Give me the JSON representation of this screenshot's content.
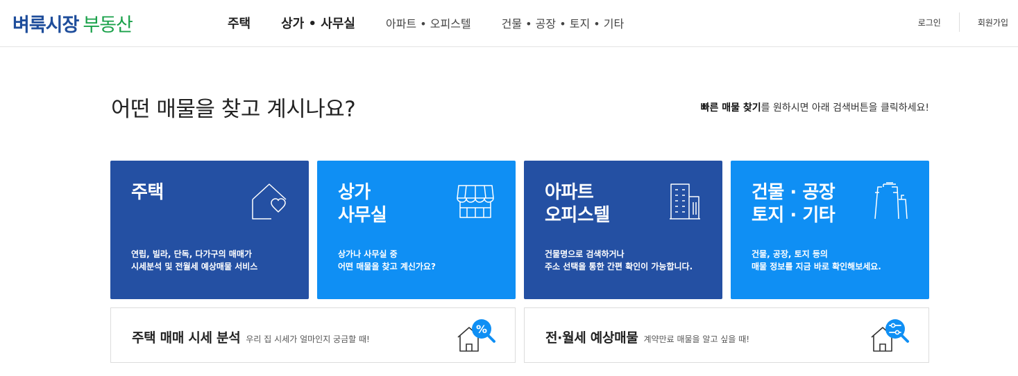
{
  "header": {
    "logo_primary": "벼룩시장",
    "logo_secondary": "부동산",
    "nav": [
      "주택",
      "상가 • 사무실",
      "아파트 • 오피스텔",
      "건물 • 공장 • 토지 • 기타"
    ],
    "login": "로그인",
    "signup": "회원가입"
  },
  "main": {
    "headline": "어떤 매물을 찾고 계시나요?",
    "hint_bold": "빠른 매물 찾기",
    "hint_rest": "를 원하시면 아래 검색버튼을 클릭하세요!"
  },
  "cards": [
    {
      "title": "주택",
      "desc": "연립, 빌라, 단독, 다가구의 매매가\n시세분석 및 전월세 예상매물 서비스",
      "icon": "house-heart-icon"
    },
    {
      "title": "상가\n사무실",
      "desc": "상가나 사무실 중\n어떤 매물을 찾고 계신가요?",
      "icon": "storefront-icon"
    },
    {
      "title": "아파트\n오피스텔",
      "desc": "건물명으로 검색하거나\n주소 선택을 통한 간편 확인이 가능합니다.",
      "icon": "apartment-building-icon"
    },
    {
      "title": "건물 · 공장\n토지 · 기타",
      "desc": "건물, 공장, 토지 등의\n매물 정보를 지금 바로 확인해보세요.",
      "icon": "factory-icon"
    }
  ],
  "bottom": [
    {
      "title": "주택 매매 시세 분석",
      "sub": "우리 집 시세가 얼마인지 궁금할 때!",
      "icon": "house-percent-search-icon"
    },
    {
      "title": "전·월세 예상매물",
      "sub": "계약만료 매물을 알고 싶을 때!",
      "icon": "house-filter-search-icon"
    }
  ],
  "colors": {
    "dark_card": "#2450a3",
    "light_card": "#0f8ff4",
    "logo_blue": "#1e4d9b",
    "logo_green": "#1aa14a"
  }
}
